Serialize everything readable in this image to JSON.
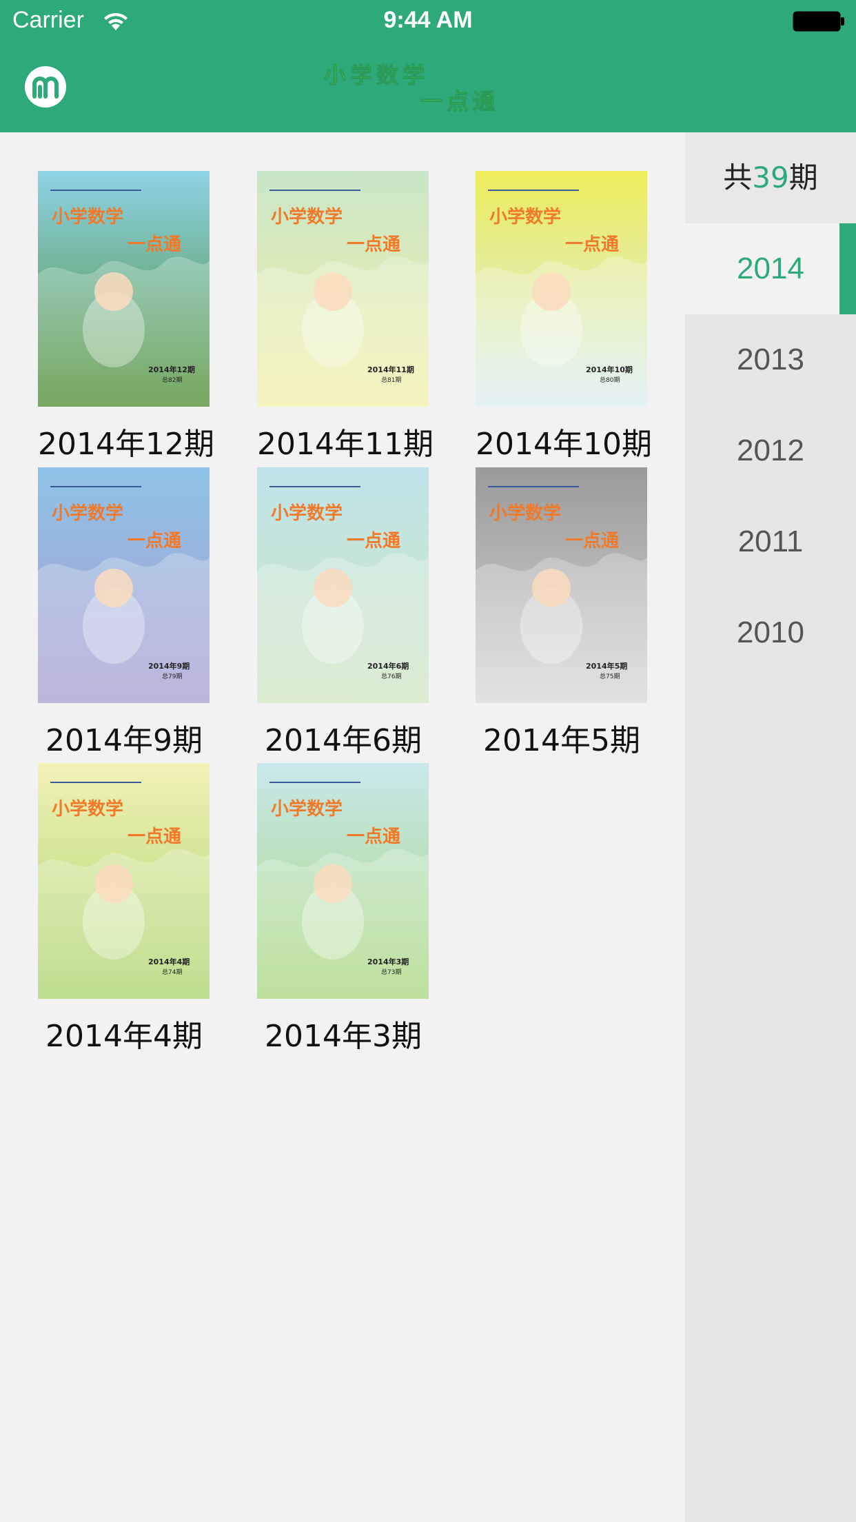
{
  "status_bar": {
    "carrier": "Carrier",
    "time": "9:44 AM"
  },
  "header": {
    "logo_icon": "m-logo-icon",
    "title_line1": "小学数学",
    "title_line2": "一点通"
  },
  "sidebar": {
    "total_prefix": "共",
    "total_count": "39",
    "total_suffix": "期",
    "years": [
      "2014",
      "2013",
      "2012",
      "2011",
      "2010"
    ],
    "selected_year": "2014"
  },
  "accent_color": "#2eaa7a",
  "issues": [
    {
      "label": "2014年12期",
      "cover_title1": "小学数学",
      "cover_title2": "一点通",
      "cover_issue": "2014年12期",
      "cover_total": "总82期",
      "bg_top": "#8fd3e8",
      "bg_bottom": "#4a8a2a"
    },
    {
      "label": "2014年11期",
      "cover_title1": "小学数学",
      "cover_title2": "一点通",
      "cover_issue": "2014年11期",
      "cover_total": "总81期",
      "bg_top": "#c9e6c8",
      "bg_bottom": "#f3f0a8"
    },
    {
      "label": "2014年10期",
      "cover_title1": "小学数学",
      "cover_title2": "一点通",
      "cover_issue": "2014年10期",
      "cover_total": "总80期",
      "bg_top": "#ecec5a",
      "bg_bottom": "#dbeef5"
    },
    {
      "label": "2014年9期",
      "cover_title1": "小学数学",
      "cover_title2": "一点通",
      "cover_issue": "2014年9期",
      "cover_total": "总79期",
      "bg_top": "#8ec3e8",
      "bg_bottom": "#a99ccf"
    },
    {
      "label": "2014年6期",
      "cover_title1": "小学数学",
      "cover_title2": "一点通",
      "cover_issue": "2014年6期",
      "cover_total": "总76期",
      "bg_top": "#bfe3ea",
      "bg_bottom": "#cfe6c0"
    },
    {
      "label": "2014年5期",
      "cover_title1": "小学数学",
      "cover_title2": "一点通",
      "cover_issue": "2014年5期",
      "cover_total": "总75期",
      "bg_top": "#9a9a9a",
      "bg_bottom": "#d8d8d8"
    },
    {
      "label": "2014年4期",
      "cover_title1": "小学数学",
      "cover_title2": "一点通",
      "cover_issue": "2014年4期",
      "cover_total": "总74期",
      "bg_top": "#f3f2b8",
      "bg_bottom": "#a8d36a"
    },
    {
      "label": "2014年3期",
      "cover_title1": "小学数学",
      "cover_title2": "一点通",
      "cover_issue": "2014年3期",
      "cover_total": "总73期",
      "bg_top": "#c8e8ec",
      "bg_bottom": "#a9d67a"
    }
  ]
}
